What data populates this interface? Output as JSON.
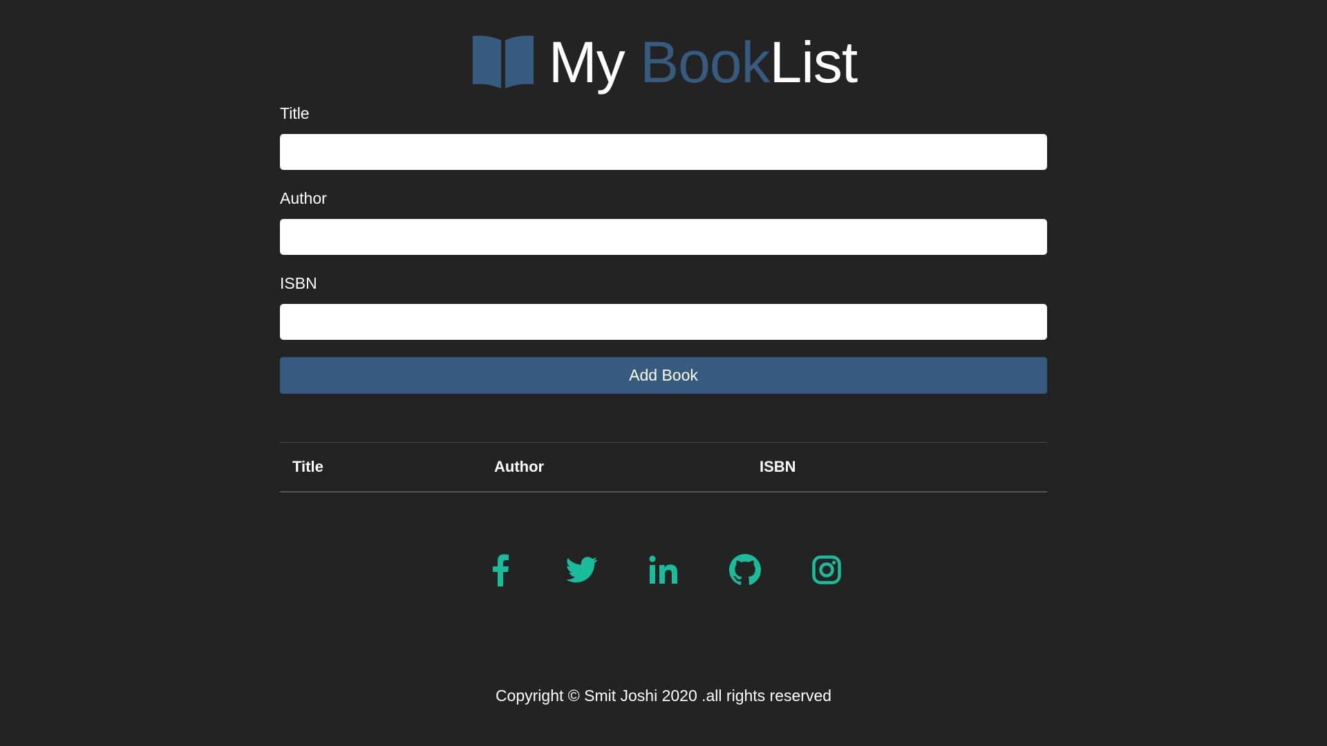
{
  "header": {
    "logo_icon": "open-book-icon",
    "title_part1": "My ",
    "title_part2": "Book",
    "title_part3": "List"
  },
  "form": {
    "title_label": "Title",
    "title_value": "",
    "author_label": "Author",
    "author_value": "",
    "isbn_label": "ISBN",
    "isbn_value": "",
    "submit_label": "Add Book"
  },
  "table": {
    "columns": [
      "Title",
      "Author",
      "ISBN"
    ],
    "rows": []
  },
  "social": {
    "icons": [
      "facebook-icon",
      "twitter-icon",
      "linkedin-icon",
      "github-icon",
      "instagram-icon"
    ],
    "color": "#1abc9c"
  },
  "footer": {
    "copyright": "Copyright © Smit Joshi 2020 .all rights reserved"
  },
  "colors": {
    "background": "#232323",
    "accent": "#375a7f",
    "social": "#1abc9c",
    "text": "#ffffff"
  }
}
